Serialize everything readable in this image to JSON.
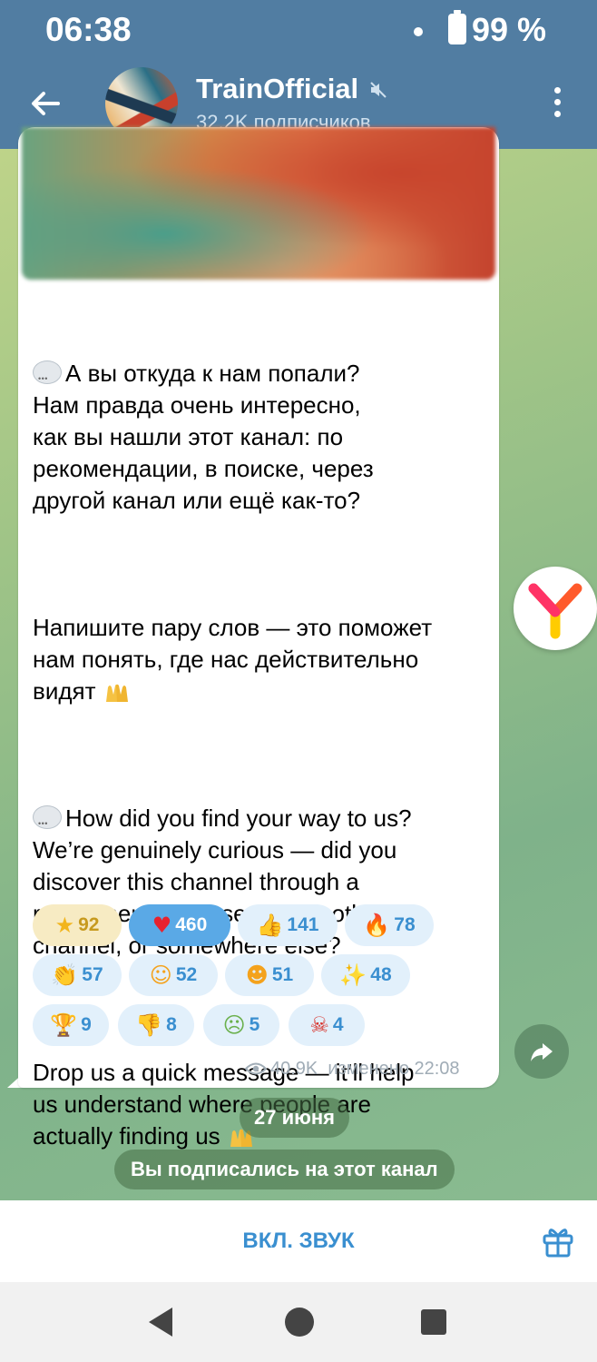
{
  "status_bar": {
    "time": "06:38",
    "battery": "99 %"
  },
  "header": {
    "title": "TrainOfficial",
    "subtitle": "32.2K подписчиков"
  },
  "message": {
    "paragraphs": [
      "А вы откуда к нам попали?\nНам правда очень интересно,\nкак вы нашли этот канал: по\nрекомендации, в поиске, через\nдругой канал или ещё как-то?",
      "Напишите пару слов — это поможет\nнам понять, где нас действительно\nвидят",
      "How did you find your way to us?\nWe’re genuinely curious — did you\ndiscover this channel through a\nrecommendation, search, another\nchannel, or somewhere else?",
      "Drop us a quick message — it’ll help\nus understand where people are\nactually finding us"
    ],
    "views": "40.9K",
    "edited": "изменено 22:08"
  },
  "reactions": [
    {
      "icon": "star-icon",
      "glyph": "★",
      "count": "92",
      "color": "#f2b51c"
    },
    {
      "icon": "heart-icon",
      "glyph": "♥",
      "count": "460",
      "color": "#e8222e"
    },
    {
      "icon": "thumbs-up-icon",
      "glyph": "👍",
      "count": "141",
      "color": "#f4b63c"
    },
    {
      "icon": "fire-icon",
      "glyph": "🔥",
      "count": "78",
      "color": "#f05a1e"
    },
    {
      "icon": "clapping-icon",
      "glyph": "👏",
      "count": "57",
      "color": "#f4b63c"
    },
    {
      "icon": "smiling-hearts-icon",
      "glyph": "☺",
      "count": "52",
      "color": "#f4a21c"
    },
    {
      "icon": "star-struck-icon",
      "glyph": "☻",
      "count": "51",
      "color": "#f4a21c"
    },
    {
      "icon": "party-popper-icon",
      "glyph": "✨",
      "count": "48",
      "color": "#e66aa0"
    },
    {
      "icon": "trophy-icon",
      "glyph": "🏆",
      "count": "9",
      "color": "#c8881a"
    },
    {
      "icon": "thumbs-down-icon",
      "glyph": "👎",
      "count": "8",
      "color": "#f4b63c"
    },
    {
      "icon": "vomiting-face-icon",
      "glyph": "☹",
      "count": "5",
      "color": "#6ab04c"
    },
    {
      "icon": "cursing-face-icon",
      "glyph": "☠",
      "count": "4",
      "color": "#d8322a"
    }
  ],
  "service": {
    "date": "27 июня",
    "joined": "Вы подписались на этот канал"
  },
  "bottom": {
    "unmute": "ВКЛ. ЗВУК"
  },
  "colors": {
    "header": "#517da2",
    "accent": "#3a8fd0"
  }
}
